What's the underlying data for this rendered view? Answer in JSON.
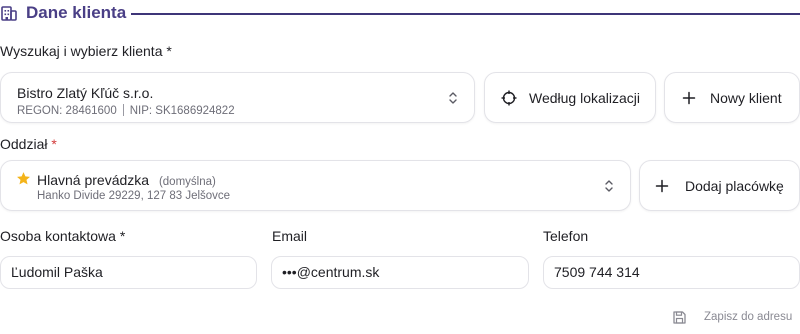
{
  "section": {
    "title": "Dane klienta",
    "icon": "building-icon",
    "accent_color": "#4a3f86"
  },
  "client": {
    "label": "Wyszukaj i wybierz klienta",
    "required_mark": "*",
    "name": "Bistro Zlatý Kľúč s.r.o.",
    "regon": "REGON: 28461600",
    "nip": "NIP: SK1686924822",
    "by_location_button": "Według lokalizacji",
    "new_client_button": "Nowy klient"
  },
  "branch": {
    "label": "Oddział",
    "required_mark": "*",
    "name": "Hlavná prevádzka",
    "default_tag": "(domyślna)",
    "address": "Hanko Divide 29229, 127 83 Jelšovce",
    "add_branch_button": "Dodaj placówkę"
  },
  "contact": {
    "person_label": "Osoba kontaktowa *",
    "person_value": "Ľudomil Paška",
    "email_label": "Email",
    "email_value": "•••@centrum.sk",
    "phone_label": "Telefon",
    "phone_value": "7509 744 314"
  },
  "footer": {
    "save_to_address": "Zapisz do adresu"
  }
}
